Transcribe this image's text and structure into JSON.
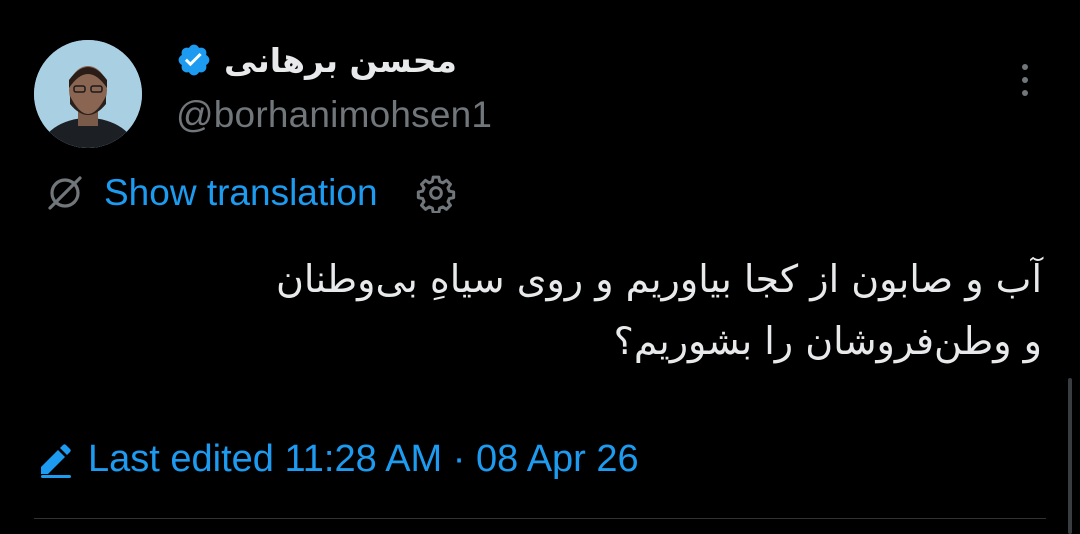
{
  "author": {
    "display_name": "محسن برهانی",
    "handle": "@borhanimohsen1",
    "verified_icon": "verified-badge-icon",
    "avatar_icon": "profile-photo"
  },
  "menu": {
    "more_icon": "more-vertical-icon"
  },
  "translation": {
    "label": "Show translation",
    "icon": "translate-icon",
    "settings_icon": "gear-icon"
  },
  "tweet": {
    "lines": [
      "آب و صابون از کجا بیاوریم و روی سیاهِ بی‌وطنان",
      "و وطن‌فروشان را بشوریم؟"
    ]
  },
  "edited": {
    "label": "Last edited 11:28 AM · 08 Apr 26",
    "icon": "pencil-edit-icon"
  },
  "colors": {
    "background": "#000000",
    "text": "#e7e9ea",
    "secondary": "#71767b",
    "accent": "#1d9bf0"
  }
}
